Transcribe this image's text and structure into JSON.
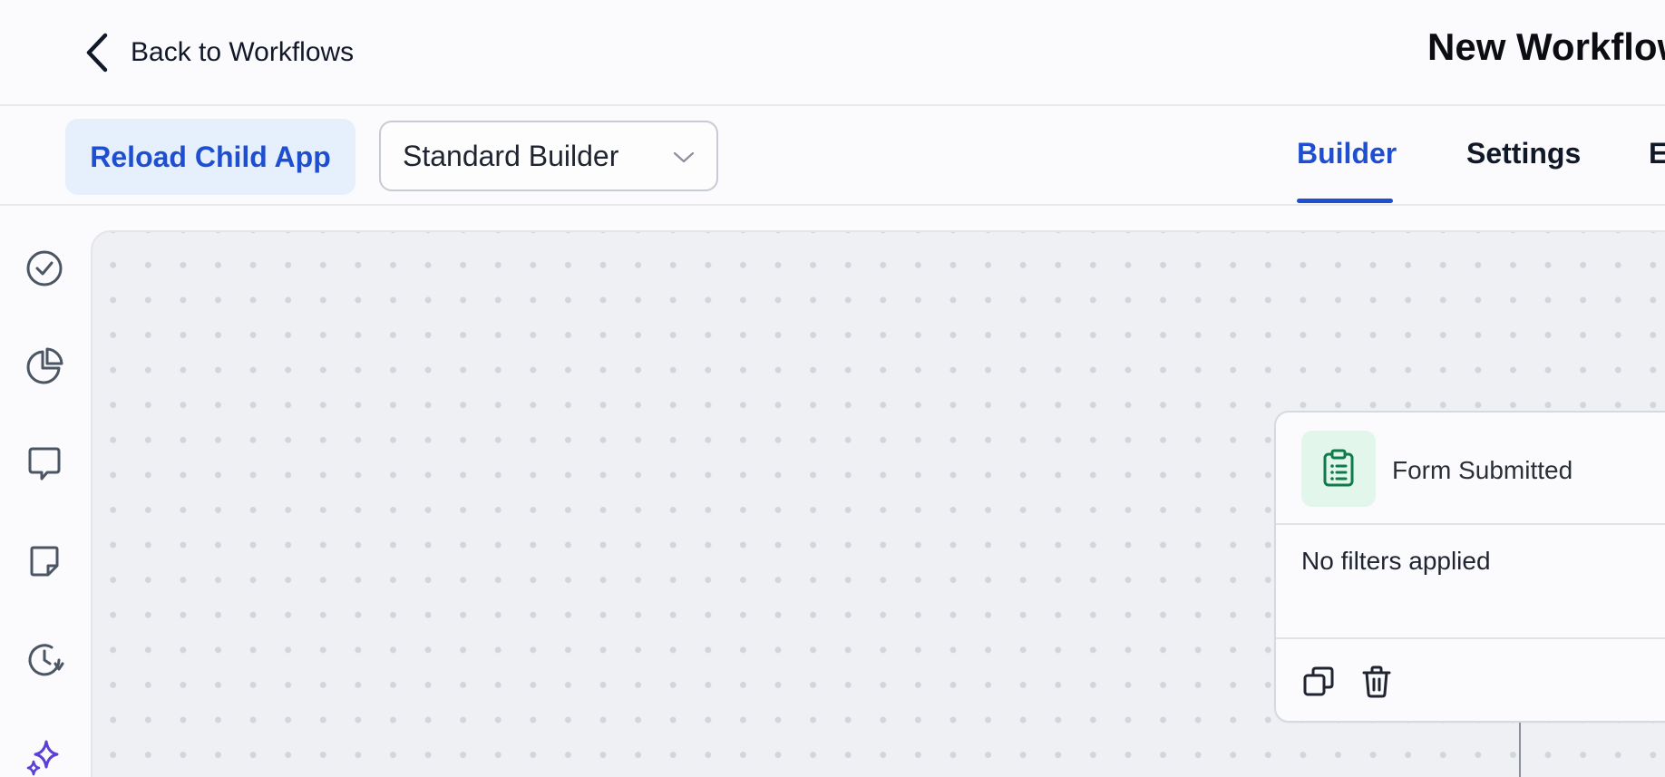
{
  "header": {
    "back_label": "Back to Workflows",
    "workflow_title": "New Workflow"
  },
  "toolbar": {
    "reload_label": "Reload Child App",
    "builder_select_value": "Standard Builder",
    "tabs": [
      {
        "label": "Builder",
        "active": true
      },
      {
        "label": "Settings",
        "active": false
      },
      {
        "label": "E",
        "active": false
      }
    ]
  },
  "rail": {
    "icons": [
      "check-circle-icon",
      "pie-chart-icon",
      "chat-bubble-icon",
      "sticky-note-icon",
      "clock-history-icon",
      "sparkles-icon"
    ]
  },
  "node": {
    "icon": "clipboard-list-icon",
    "title": "Form Submitted",
    "body": "No filters applied",
    "actions": [
      "copy-icon",
      "trash-icon"
    ]
  },
  "colors": {
    "accent": "#1f4fd1",
    "accent_bg": "#e6effc",
    "node_icon_green": "#0f7a4a",
    "node_icon_bg": "#e3f6ec",
    "sparkle_purple": "#5b3fd6"
  }
}
